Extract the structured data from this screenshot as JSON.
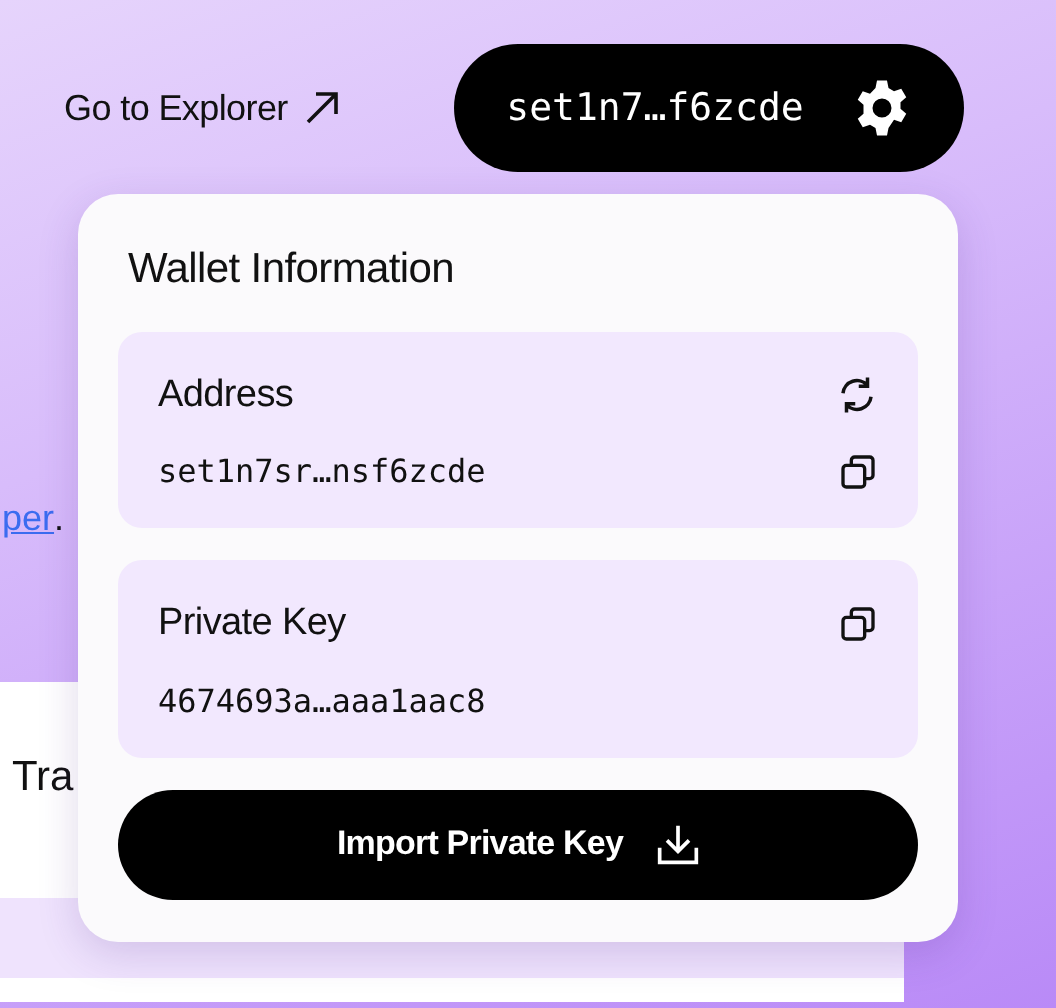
{
  "header": {
    "explorer_link": "Go to Explorer",
    "account_button": "set1n7…f6zcde"
  },
  "page": {
    "link_fragment": "per",
    "link_suffix": ".",
    "card_title": "Tra"
  },
  "wallet_popup": {
    "title": "Wallet Information",
    "sections": [
      {
        "label": "Address",
        "value": "set1n7sr…nsf6zcde",
        "kind": "address"
      },
      {
        "label": "Private Key",
        "value": "4674693a…aaa1aac8",
        "kind": "key"
      }
    ],
    "import_button": "Import Private Key"
  }
}
